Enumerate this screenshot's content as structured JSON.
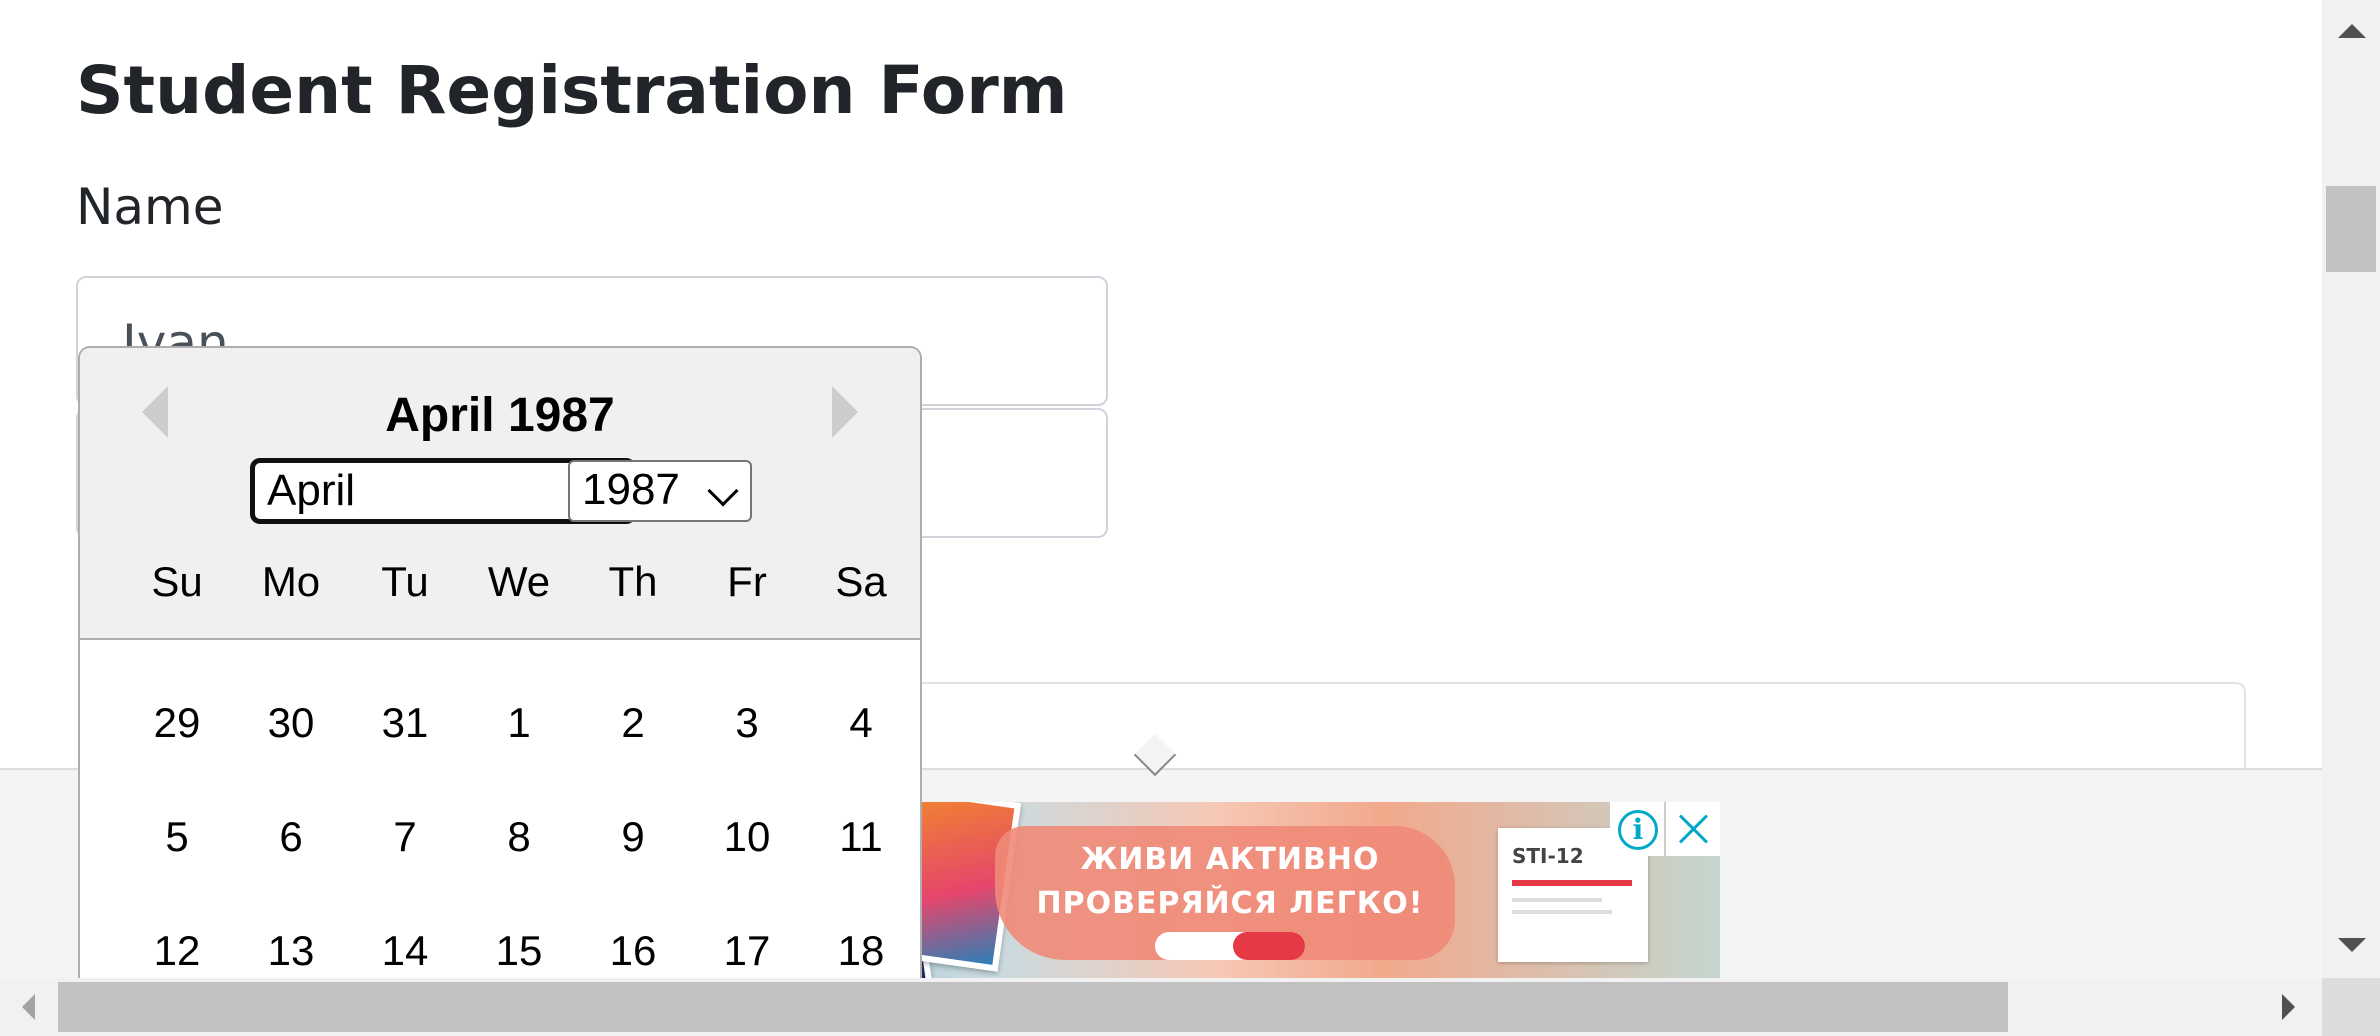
{
  "form": {
    "title": "Student Registration Form",
    "name_label": "Name",
    "first_name_value": "Ivan"
  },
  "datepicker": {
    "title": "April 1987",
    "month_selected": "April",
    "year_selected": "1987",
    "weekdays": [
      "Su",
      "Mo",
      "Tu",
      "We",
      "Th",
      "Fr",
      "Sa"
    ],
    "weeks": [
      [
        "29",
        "30",
        "31",
        "1",
        "2",
        "3",
        "4"
      ],
      [
        "5",
        "6",
        "7",
        "8",
        "9",
        "10",
        "11"
      ],
      [
        "12",
        "13",
        "14",
        "15",
        "16",
        "17",
        "18"
      ]
    ]
  },
  "ad": {
    "headline_1": "ЖИВИ АКТИВНО",
    "headline_2": "ПРОВЕРЯЙСЯ ЛЕГКО!",
    "product_label": "STI-12",
    "accent_color": "#00a9c8"
  }
}
